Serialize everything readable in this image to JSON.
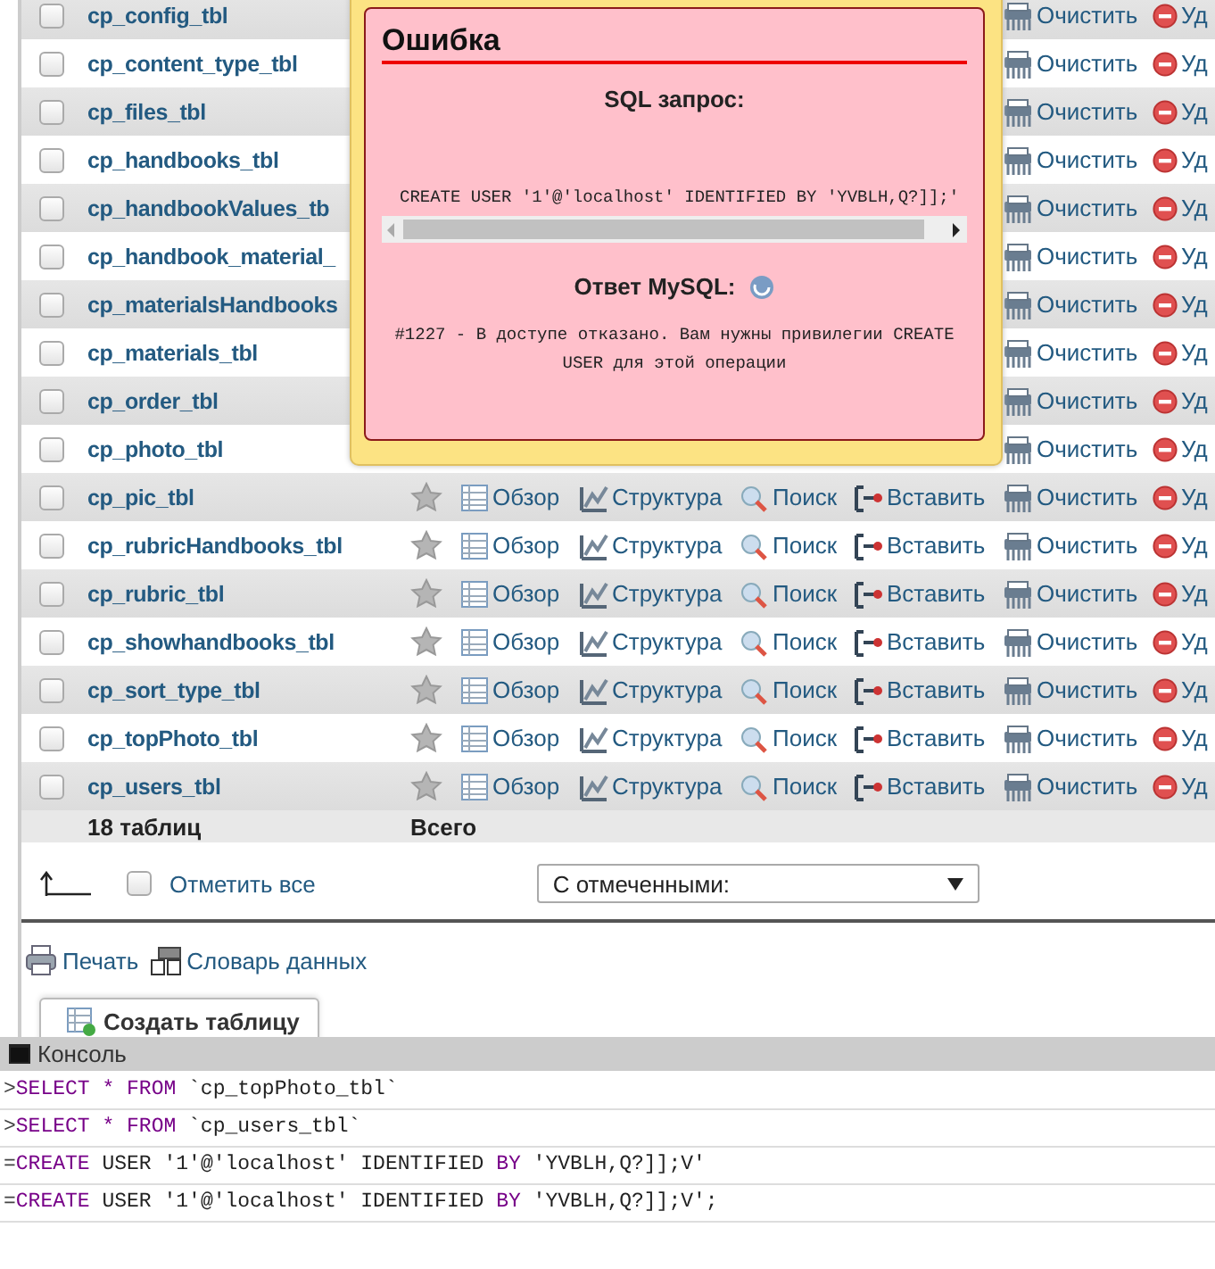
{
  "tables": {
    "rows": [
      {
        "name": "cp_config_tbl",
        "checked": false,
        "actions": [
          {
            "kind": "empty",
            "label": "Очистить"
          },
          {
            "kind": "drop",
            "label": "Уд"
          }
        ]
      },
      {
        "name": "cp_content_type_tbl",
        "checked": false,
        "actions": [
          {
            "kind": "empty",
            "label": "Очистить"
          },
          {
            "kind": "drop",
            "label": "Уд"
          }
        ]
      },
      {
        "name": "cp_files_tbl",
        "checked": false,
        "actions": [
          {
            "kind": "empty",
            "label": "Очистить"
          },
          {
            "kind": "drop",
            "label": "Уд"
          }
        ]
      },
      {
        "name": "cp_handbooks_tbl",
        "checked": false,
        "actions": [
          {
            "kind": "empty",
            "label": "Очистить"
          },
          {
            "kind": "drop",
            "label": "Уд"
          }
        ]
      },
      {
        "name": "cp_handbookValues_tb",
        "checked": false,
        "actions": [
          {
            "kind": "empty",
            "label": "Очистить"
          },
          {
            "kind": "drop",
            "label": "Уд"
          }
        ]
      },
      {
        "name": "cp_handbook_material_",
        "checked": false,
        "actions": [
          {
            "kind": "empty",
            "label": "Очистить"
          },
          {
            "kind": "drop",
            "label": "Уд"
          }
        ]
      },
      {
        "name": "cp_materialsHandbooks",
        "checked": false,
        "actions": [
          {
            "kind": "empty",
            "label": "Очистить"
          },
          {
            "kind": "drop",
            "label": "Уд"
          }
        ]
      },
      {
        "name": "cp_materials_tbl",
        "checked": false,
        "actions": [
          {
            "kind": "empty",
            "label": "Очистить"
          },
          {
            "kind": "drop",
            "label": "Уд"
          }
        ]
      },
      {
        "name": "cp_order_tbl",
        "checked": false,
        "actions": [
          {
            "kind": "empty",
            "label": "Очистить"
          },
          {
            "kind": "drop",
            "label": "Уд"
          }
        ]
      },
      {
        "name": "cp_photo_tbl",
        "checked": false,
        "actions": [
          {
            "kind": "empty",
            "label": "Очистить"
          },
          {
            "kind": "drop",
            "label": "Уд"
          }
        ]
      },
      {
        "name": "cp_pic_tbl",
        "checked": false,
        "actions": [
          {
            "kind": "favorite"
          },
          {
            "kind": "browse",
            "label": "Обзор"
          },
          {
            "kind": "structure",
            "label": "Структура"
          },
          {
            "kind": "search",
            "label": "Поиск"
          },
          {
            "kind": "insert",
            "label": "Вставить"
          },
          {
            "kind": "empty",
            "label": "Очистить"
          },
          {
            "kind": "drop",
            "label": "Уд"
          }
        ]
      },
      {
        "name": "cp_rubricHandbooks_tbl",
        "checked": false,
        "actions": [
          {
            "kind": "favorite"
          },
          {
            "kind": "browse",
            "label": "Обзор"
          },
          {
            "kind": "structure",
            "label": "Структура"
          },
          {
            "kind": "search",
            "label": "Поиск"
          },
          {
            "kind": "insert",
            "label": "Вставить"
          },
          {
            "kind": "empty",
            "label": "Очистить"
          },
          {
            "kind": "drop",
            "label": "Уд"
          }
        ]
      },
      {
        "name": "cp_rubric_tbl",
        "checked": false,
        "actions": [
          {
            "kind": "favorite"
          },
          {
            "kind": "browse",
            "label": "Обзор"
          },
          {
            "kind": "structure",
            "label": "Структура"
          },
          {
            "kind": "search",
            "label": "Поиск"
          },
          {
            "kind": "insert",
            "label": "Вставить"
          },
          {
            "kind": "empty",
            "label": "Очистить"
          },
          {
            "kind": "drop",
            "label": "Уд"
          }
        ]
      },
      {
        "name": "cp_showhandbooks_tbl",
        "checked": false,
        "actions": [
          {
            "kind": "favorite"
          },
          {
            "kind": "browse",
            "label": "Обзор"
          },
          {
            "kind": "structure",
            "label": "Структура"
          },
          {
            "kind": "search",
            "label": "Поиск"
          },
          {
            "kind": "insert",
            "label": "Вставить"
          },
          {
            "kind": "empty",
            "label": "Очистить"
          },
          {
            "kind": "drop",
            "label": "Уд"
          }
        ]
      },
      {
        "name": "cp_sort_type_tbl",
        "checked": false,
        "actions": [
          {
            "kind": "favorite"
          },
          {
            "kind": "browse",
            "label": "Обзор"
          },
          {
            "kind": "structure",
            "label": "Структура"
          },
          {
            "kind": "search",
            "label": "Поиск"
          },
          {
            "kind": "insert",
            "label": "Вставить"
          },
          {
            "kind": "empty",
            "label": "Очистить"
          },
          {
            "kind": "drop",
            "label": "Уд"
          }
        ]
      },
      {
        "name": "cp_topPhoto_tbl",
        "checked": false,
        "actions": [
          {
            "kind": "favorite"
          },
          {
            "kind": "browse",
            "label": "Обзор"
          },
          {
            "kind": "structure",
            "label": "Структура"
          },
          {
            "kind": "search",
            "label": "Поиск"
          },
          {
            "kind": "insert",
            "label": "Вставить"
          },
          {
            "kind": "empty",
            "label": "Очистить"
          },
          {
            "kind": "drop",
            "label": "Уд"
          }
        ]
      },
      {
        "name": "cp_users_tbl",
        "checked": false,
        "actions": [
          {
            "kind": "favorite"
          },
          {
            "kind": "browse",
            "label": "Обзор"
          },
          {
            "kind": "structure",
            "label": "Структура"
          },
          {
            "kind": "search",
            "label": "Поиск"
          },
          {
            "kind": "insert",
            "label": "Вставить"
          },
          {
            "kind": "empty",
            "label": "Очистить"
          },
          {
            "kind": "drop",
            "label": "Уд"
          }
        ]
      }
    ],
    "footer": {
      "count": "18 таблиц",
      "total": "Всего"
    }
  },
  "bulk": {
    "check_all": {
      "label": "Отметить все",
      "checked": false
    },
    "with_selected": "С отмеченными:"
  },
  "links": [
    {
      "kind": "print",
      "label": "Печать"
    },
    {
      "kind": "dictionary",
      "label": "Словарь данных"
    }
  ],
  "create_table": "Создать таблицу",
  "console": {
    "title": "Консоль",
    "lines": [
      [
        {
          "kind": "prompt",
          "text": ">"
        },
        {
          "kind": "keyword",
          "text": "SELECT * FROM"
        },
        {
          "kind": "plain",
          "text": " `cp_topPhoto_tbl`"
        }
      ],
      [
        {
          "kind": "prompt",
          "text": ">"
        },
        {
          "kind": "keyword",
          "text": "SELECT * FROM"
        },
        {
          "kind": "plain",
          "text": " `cp_users_tbl`"
        }
      ],
      [
        {
          "kind": "prompt",
          "text": "="
        },
        {
          "kind": "keyword",
          "text": "CREATE"
        },
        {
          "kind": "plain",
          "text": " USER '1'@'localhost' IDENTIFIED "
        },
        {
          "kind": "keyword",
          "text": "BY"
        },
        {
          "kind": "plain",
          "text": " 'YVBLH,Q?]];V'"
        }
      ],
      [
        {
          "kind": "prompt",
          "text": "="
        },
        {
          "kind": "keyword",
          "text": "CREATE"
        },
        {
          "kind": "plain",
          "text": " USER '1'@'localhost' IDENTIFIED "
        },
        {
          "kind": "keyword",
          "text": "BY"
        },
        {
          "kind": "plain",
          "text": " 'YVBLH,Q?]];V';"
        }
      ]
    ]
  },
  "error_dialog": {
    "title": "Ошибка",
    "query_heading": "SQL запрос:",
    "query": "CREATE USER '1'@'localhost' IDENTIFIED BY 'YVBLH,Q?]];'",
    "response_heading": "Ответ MySQL:",
    "response": "#1227 - В доступе отказано. Вам нужны привилегии CREATE USER для этой операции"
  }
}
